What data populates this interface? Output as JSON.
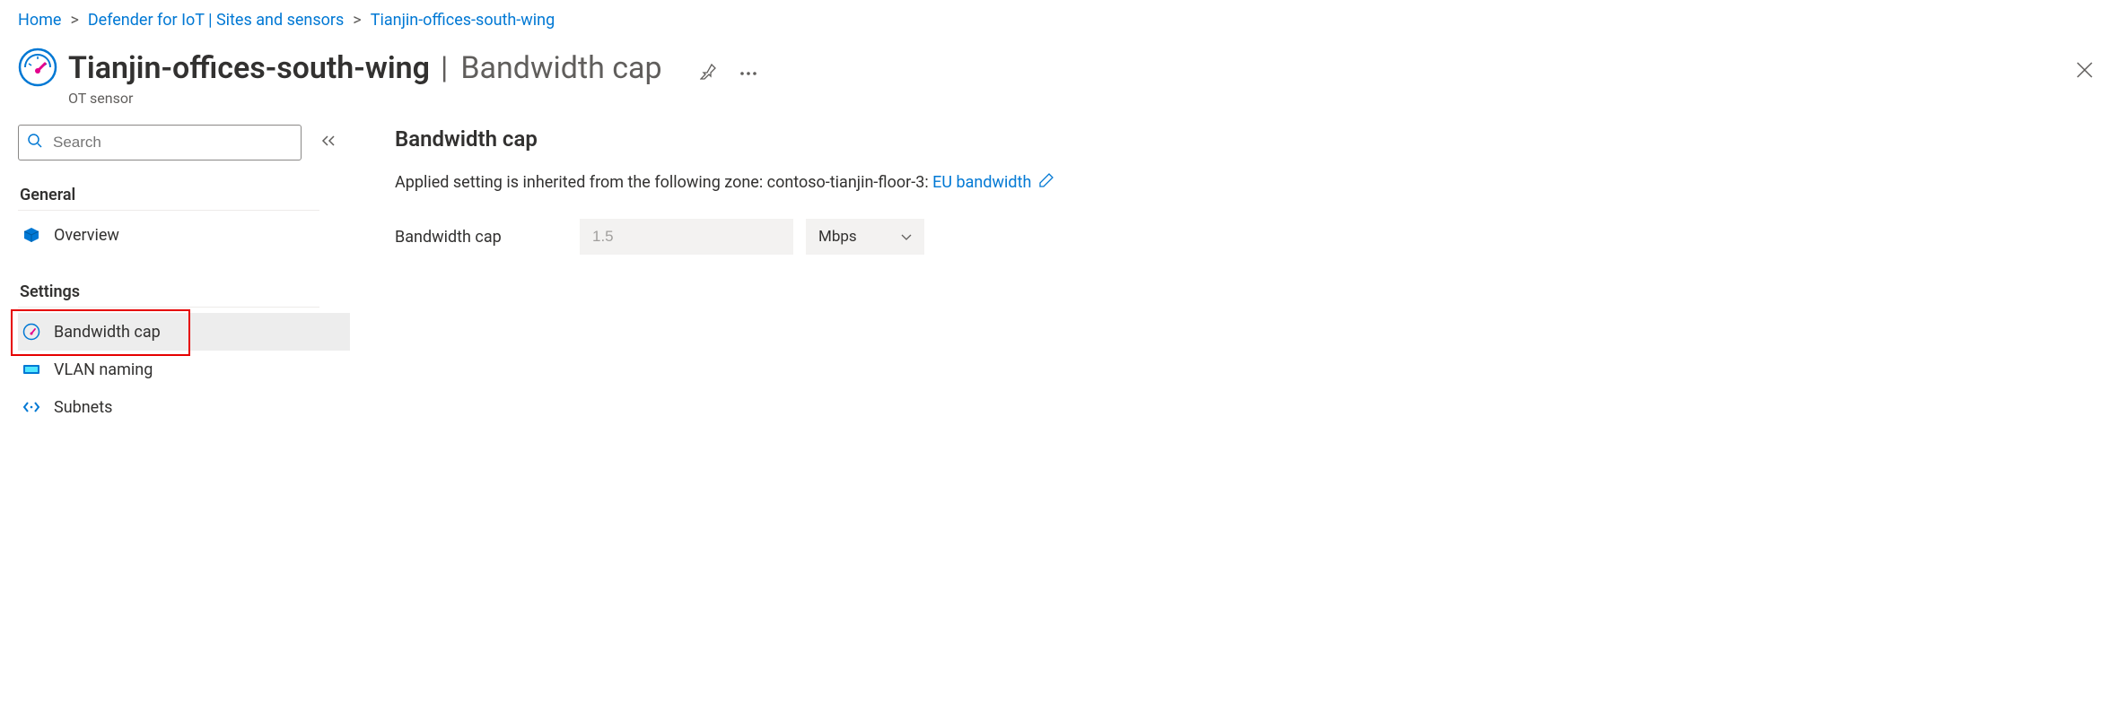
{
  "breadcrumb": {
    "items": [
      {
        "label": "Home"
      },
      {
        "label": "Defender for IoT | Sites and sensors"
      },
      {
        "label": "Tianjin-offices-south-wing"
      }
    ]
  },
  "header": {
    "title_main": "Tianjin-offices-south-wing",
    "title_separator": "|",
    "title_context": "Bandwidth cap",
    "subtitle": "OT sensor"
  },
  "sidebar": {
    "search_placeholder": "Search",
    "sections": [
      {
        "name": "General",
        "items": [
          {
            "label": "Overview",
            "icon": "cube-icon"
          }
        ]
      },
      {
        "name": "Settings",
        "items": [
          {
            "label": "Bandwidth cap",
            "icon": "gauge-icon",
            "selected": true,
            "highlighted": true
          },
          {
            "label": "VLAN naming",
            "icon": "tag-icon"
          },
          {
            "label": "Subnets",
            "icon": "code-icon"
          }
        ]
      }
    ]
  },
  "content": {
    "title": "Bandwidth cap",
    "inherited_prefix": "Applied setting is inherited from the following zone: contoso-tianjin-floor-3: ",
    "inherited_link": "EU bandwidth",
    "form": {
      "label": "Bandwidth cap",
      "value": "1.5",
      "unit": "Mbps"
    }
  }
}
